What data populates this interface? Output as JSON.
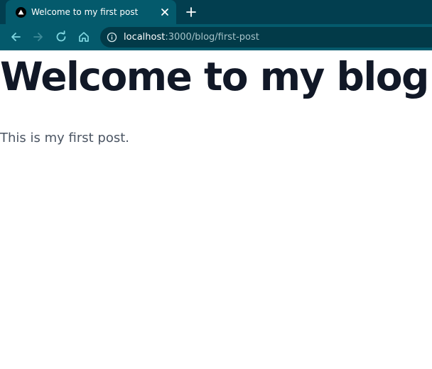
{
  "browser": {
    "tab": {
      "title": "Welcome to my first post",
      "favicon": "triangle-logo-icon",
      "close_icon": "close-icon"
    },
    "new_tab_icon": "plus-icon",
    "toolbar": {
      "back_icon": "arrow-left-icon",
      "forward_icon": "arrow-right-icon",
      "reload_icon": "reload-icon",
      "home_icon": "home-icon",
      "site_info_icon": "info-icon"
    },
    "address": {
      "host": "localhost",
      "rest": ":3000/blog/first-post"
    },
    "colors": {
      "tabstrip": "#023e4f",
      "toolbar": "#045a6c",
      "omnibox": "#023a48",
      "icon": "#7fd6e0"
    }
  },
  "page": {
    "title": "Welcome to my blog!",
    "body": "This is my first post."
  }
}
